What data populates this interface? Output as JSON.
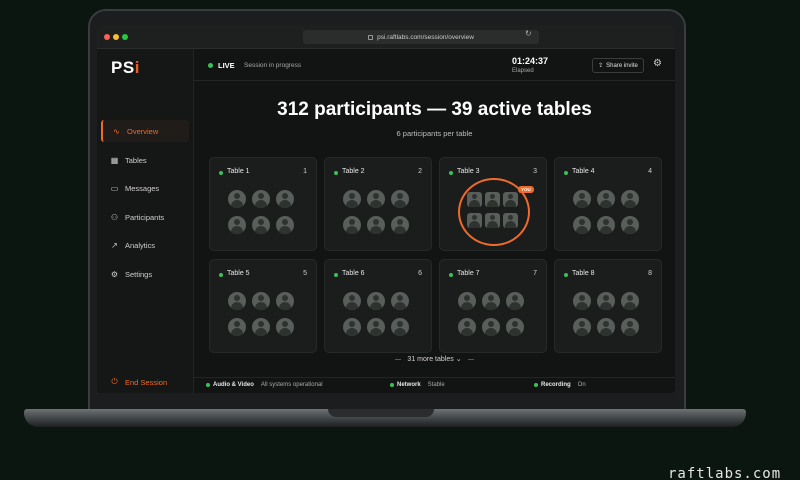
{
  "browser": {
    "url": "psi.raftlabs.com/session/overview"
  },
  "app": {
    "logo_main": "PS",
    "logo_accent": "i"
  },
  "sidebar": {
    "items": [
      {
        "label": "Overview",
        "icon": "pulse-icon"
      },
      {
        "label": "Tables",
        "icon": "grid-icon"
      },
      {
        "label": "Messages",
        "icon": "chat-icon"
      },
      {
        "label": "Participants",
        "icon": "users-icon"
      },
      {
        "label": "Analytics",
        "icon": "chart-icon"
      },
      {
        "label": "Settings",
        "icon": "gear-icon"
      }
    ],
    "end_session": "End Session"
  },
  "topbar": {
    "live": "LIVE",
    "status": "Session in progress",
    "timer": "01:24:37",
    "elapsed_label": "Elapsed",
    "share_label": "Share invite"
  },
  "main": {
    "headline": "312 participants — 39 active tables",
    "subline": "6 participants per table",
    "tables": [
      {
        "name": "Table 1",
        "num": "1"
      },
      {
        "name": "Table 2",
        "num": "2"
      },
      {
        "name": "Table 3",
        "num": "3",
        "badge": "YOU"
      },
      {
        "name": "Table 4",
        "num": "4"
      },
      {
        "name": "Table 5",
        "num": "5"
      },
      {
        "name": "Table 6",
        "num": "6"
      },
      {
        "name": "Table 7",
        "num": "7"
      },
      {
        "name": "Table 8",
        "num": "8"
      }
    ],
    "more_label": "31 more tables"
  },
  "status": {
    "av_label": "Audio & Video",
    "av_value": "All systems operational",
    "network_label": "Network",
    "network_value": "Stable",
    "recording_label": "Recording",
    "recording_value": "On"
  },
  "watermark": "raftlabs.com",
  "colors": {
    "accent": "#f06a2a",
    "live": "#3cc05a",
    "background": "#0b1610"
  }
}
